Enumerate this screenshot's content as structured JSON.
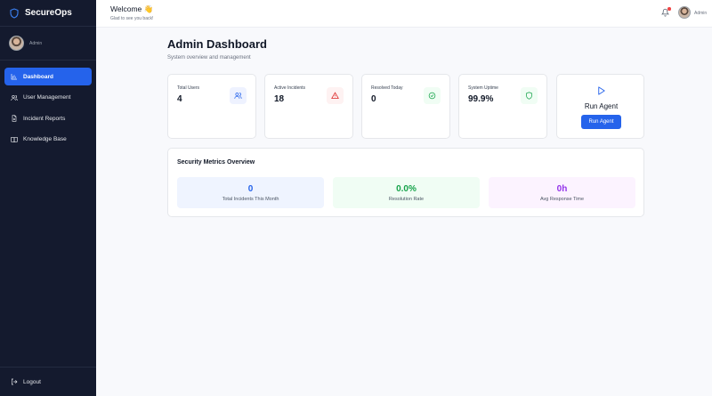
{
  "app": {
    "name": "SecureOps"
  },
  "sidebar": {
    "user": {
      "name": "Admin"
    },
    "items": [
      {
        "label": "Dashboard",
        "icon": "bar-chart-icon",
        "active": true
      },
      {
        "label": "User Management",
        "icon": "users-icon"
      },
      {
        "label": "Incident Reports",
        "icon": "file-text-icon"
      },
      {
        "label": "Knowledge Base",
        "icon": "book-open-icon"
      }
    ],
    "logout_label": "Logout"
  },
  "topbar": {
    "welcome_title": "Welcome 👋",
    "welcome_sub": "Glad to see you back!",
    "user_name": "Admin",
    "has_notification": true
  },
  "page": {
    "title": "Admin Dashboard",
    "subtitle": "System overview and management"
  },
  "stats": [
    {
      "label": "Total Users",
      "value": "4",
      "icon": "users-icon",
      "color": "#2563eb",
      "bg": "#eef2ff"
    },
    {
      "label": "Active Incidents",
      "value": "18",
      "icon": "alert-triangle-icon",
      "color": "#dc2626",
      "bg": "#fef2f2"
    },
    {
      "label": "Resolved Today",
      "value": "0",
      "icon": "check-circle-icon",
      "color": "#16a34a",
      "bg": "#f0fdf4"
    },
    {
      "label": "System Uptime",
      "value": "99.9%",
      "icon": "shield-icon",
      "color": "#16a34a",
      "bg": "#f0fdf4"
    }
  ],
  "agent": {
    "title": "Run Agent",
    "button_label": "Run Agent",
    "accent": "#2563eb"
  },
  "metrics": {
    "title": "Security Metrics Overview",
    "items": [
      {
        "value": "0",
        "label": "Total Incidents This Month",
        "color": "#2563eb",
        "bg": "#eff4ff"
      },
      {
        "value": "0.0%",
        "label": "Resolution Rate",
        "color": "#16a34a",
        "bg": "#f0fdf4"
      },
      {
        "value": "0h",
        "label": "Avg Response Time",
        "color": "#9333ea",
        "bg": "#fcf3ff"
      }
    ]
  }
}
